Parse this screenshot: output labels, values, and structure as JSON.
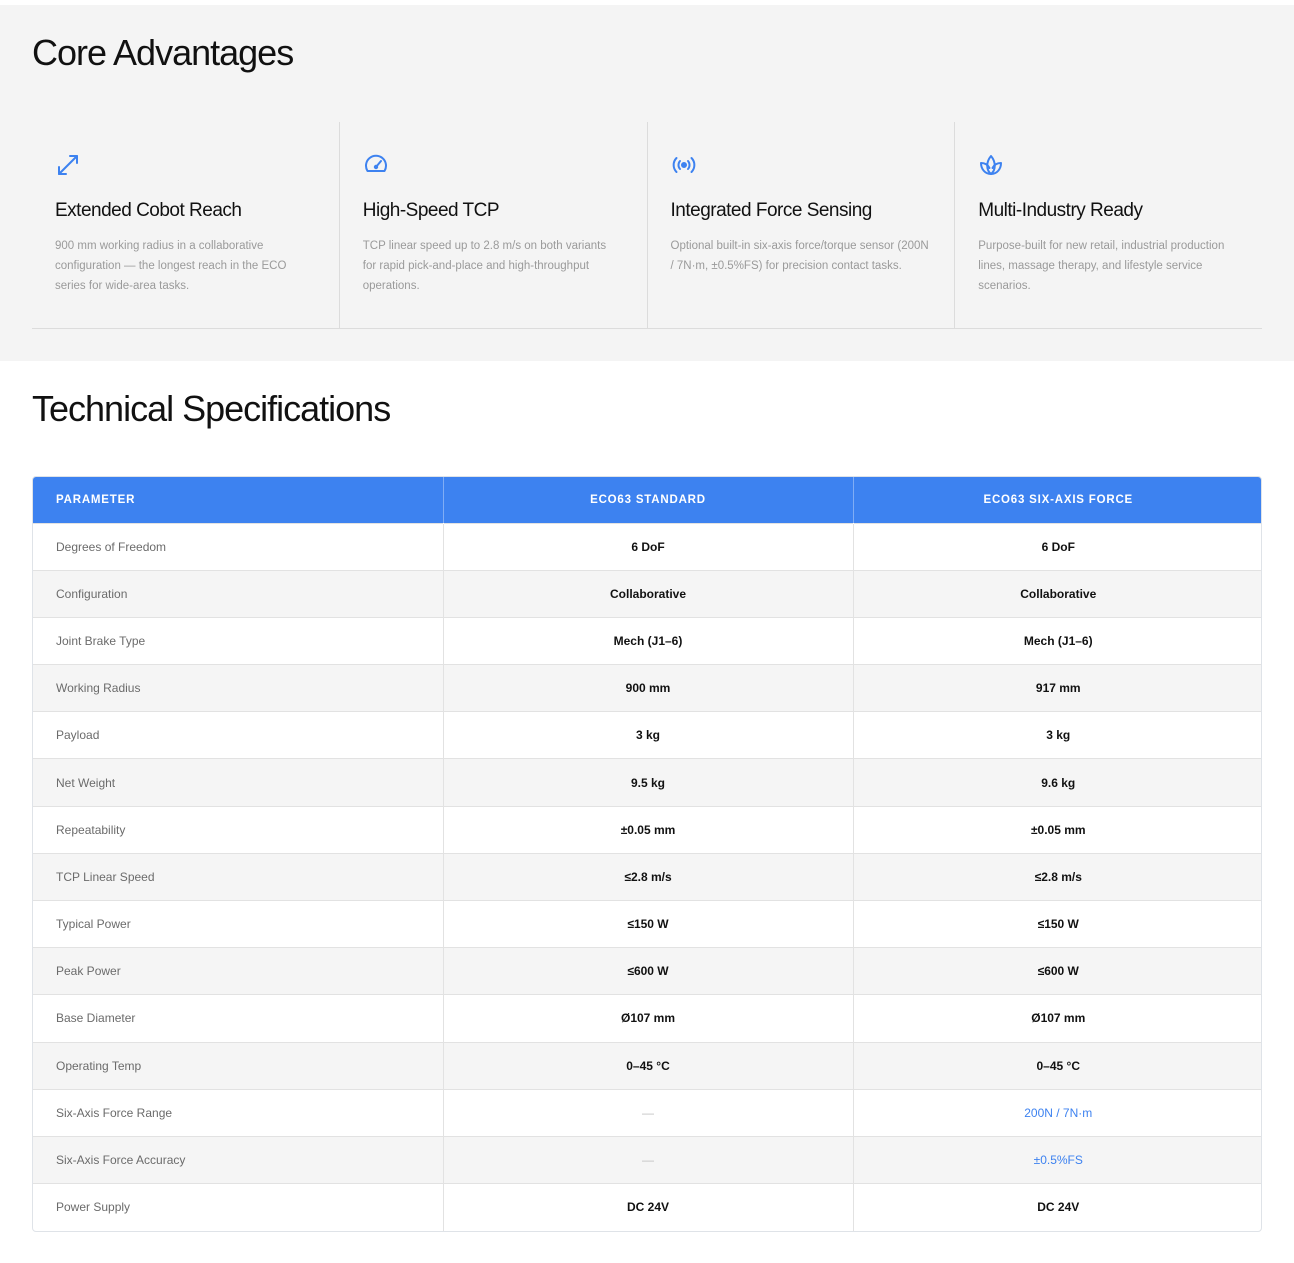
{
  "accent_color": "#3d82f0",
  "advantages": {
    "title": "Core Advantages",
    "items": [
      {
        "icon": "expand-arrows-icon",
        "title": "Extended Cobot Reach",
        "desc": "900 mm working radius in a collaborative configuration — the longest reach in the ECO series for wide-area tasks."
      },
      {
        "icon": "speedometer-icon",
        "title": "High-Speed TCP",
        "desc": "TCP linear speed up to 2.8 m/s on both variants for rapid pick-and-place and high-throughput operations."
      },
      {
        "icon": "signal-broadcast-icon",
        "title": "Integrated Force Sensing",
        "desc": "Optional built-in six-axis force/torque sensor (200N / 7N·m, ±0.5%FS) for precision contact tasks."
      },
      {
        "icon": "lotus-icon",
        "title": "Multi-Industry Ready",
        "desc": "Purpose-built for new retail, industrial production lines, massage therapy, and lifestyle service scenarios."
      }
    ]
  },
  "specs": {
    "title": "Technical Specifications",
    "headers": [
      "PARAMETER",
      "ECO63 STANDARD",
      "ECO63 SIX-AXIS FORCE"
    ],
    "rows": [
      {
        "param": "Degrees of Freedom",
        "standard": "6 DoF",
        "force": "6 DoF"
      },
      {
        "param": "Configuration",
        "standard": "Collaborative",
        "force": "Collaborative"
      },
      {
        "param": "Joint Brake Type",
        "standard": "Mech (J1–6)",
        "force": "Mech (J1–6)"
      },
      {
        "param": "Working Radius",
        "standard": "900 mm",
        "force": "917 mm"
      },
      {
        "param": "Payload",
        "standard": "3 kg",
        "force": "3 kg"
      },
      {
        "param": "Net Weight",
        "standard": "9.5 kg",
        "force": "9.6 kg"
      },
      {
        "param": "Repeatability",
        "standard": "±0.05 mm",
        "force": "±0.05 mm"
      },
      {
        "param": "TCP Linear Speed",
        "standard": "≤2.8 m/s",
        "force": "≤2.8 m/s"
      },
      {
        "param": "Typical Power",
        "standard": "≤150 W",
        "force": "≤150 W"
      },
      {
        "param": "Peak Power",
        "standard": "≤600 W",
        "force": "≤600 W"
      },
      {
        "param": "Base Diameter",
        "standard": "Ø107 mm",
        "force": "Ø107 mm"
      },
      {
        "param": "Operating Temp",
        "standard": "0–45 °C",
        "force": "0–45 °C"
      },
      {
        "param": "Six-Axis Force Range",
        "standard": "—",
        "force": "200N / 7N·m"
      },
      {
        "param": "Six-Axis Force Accuracy",
        "standard": "—",
        "force": "±0.5%FS"
      },
      {
        "param": "Power Supply",
        "standard": "DC 24V",
        "force": "DC 24V"
      }
    ]
  }
}
